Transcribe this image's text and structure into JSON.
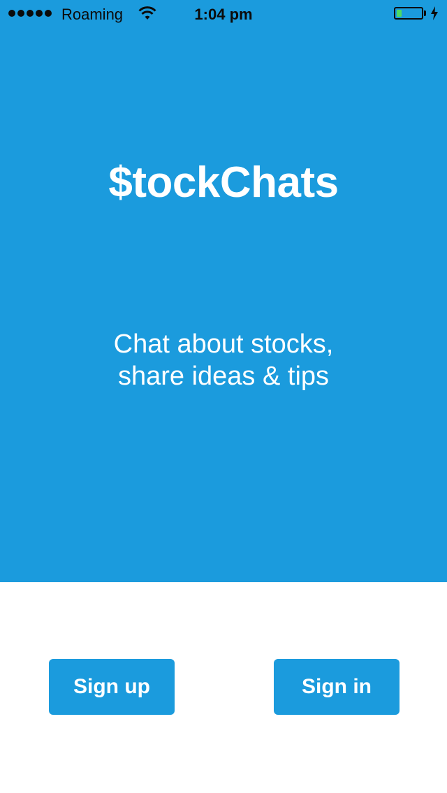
{
  "status_bar": {
    "signal_strength": 5,
    "carrier": "Roaming",
    "wifi_icon": "wifi-icon",
    "time": "1:04 pm",
    "battery_level": 0.22,
    "battery_fill_color": "#4cd964",
    "charging_icon": "bolt-icon"
  },
  "colors": {
    "accent": "#1b9bdd",
    "background": "#ffffff",
    "text_on_accent": "#ffffff"
  },
  "hero": {
    "app_title": "$tockChats",
    "tagline_line1": "Chat about stocks,",
    "tagline_line2": "share ideas & tips"
  },
  "actions": {
    "sign_up_label": "Sign up",
    "sign_in_label": "Sign in"
  }
}
